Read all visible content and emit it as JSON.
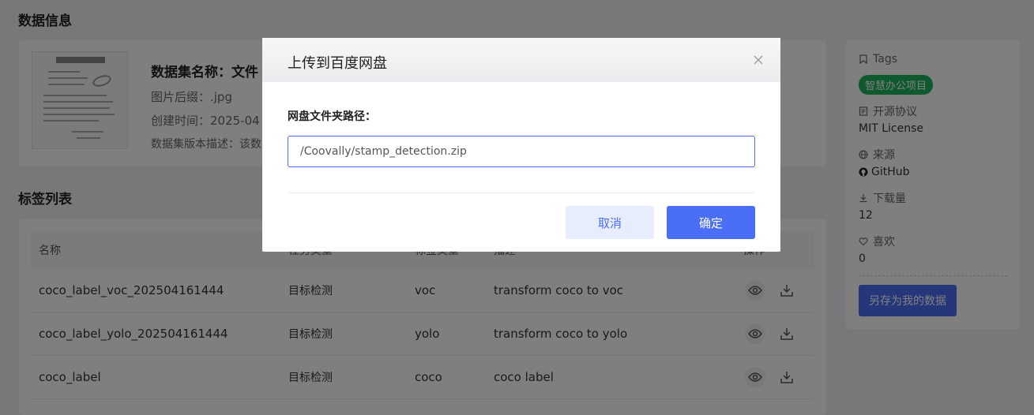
{
  "sections": {
    "info_title": "数据信息",
    "labels_title": "标签列表"
  },
  "dataset": {
    "name": "数据集名称：文件",
    "suffix": "图片后缀：.jpg",
    "created": "创建时间：2025-04",
    "description": "数据集版本描述：该数"
  },
  "sidebar": {
    "tags_label": "Tags",
    "tag": "智慧办公项目",
    "license_label": "开源协议",
    "license_value": "MIT License",
    "source_label": "来源",
    "source_value": "GitHub",
    "downloads_label": "下载量",
    "downloads_value": "12",
    "likes_label": "喜欢",
    "likes_value": "0",
    "save_button": "另存为我的数据"
  },
  "table": {
    "columns": [
      "名称",
      "任务类型",
      "标签类型",
      "描述",
      "操作"
    ],
    "rows": [
      {
        "name": "coco_label_voc_202504161444",
        "task": "目标检测",
        "type": "voc",
        "desc": "transform coco to voc"
      },
      {
        "name": "coco_label_yolo_202504161444",
        "task": "目标检测",
        "type": "yolo",
        "desc": "transform coco to yolo"
      },
      {
        "name": "coco_label",
        "task": "目标检测",
        "type": "coco",
        "desc": "coco label"
      }
    ]
  },
  "dialog": {
    "title": "上传到百度网盘",
    "field_label": "网盘文件夹路径：",
    "field_value": "/Coovally/stamp_detection.zip",
    "cancel": "取消",
    "confirm": "确定"
  },
  "colors": {
    "accent": "#4a6ef5",
    "tag_green": "#1db35b"
  }
}
